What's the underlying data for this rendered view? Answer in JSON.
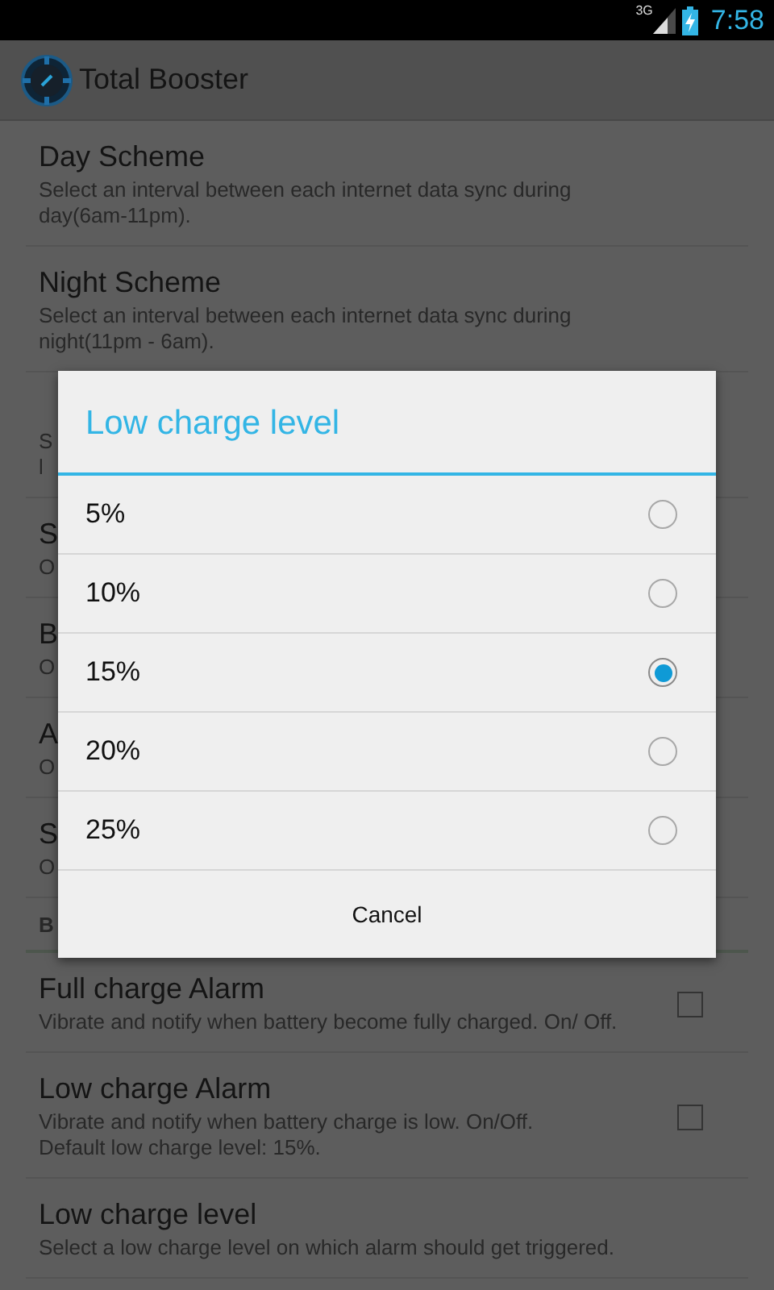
{
  "status_bar": {
    "network": "3G",
    "time": "7:58"
  },
  "app_bar": {
    "title": "Total Booster"
  },
  "settings": [
    {
      "kind": "row",
      "title": "Day Scheme",
      "summary": "Select an interval between each internet data sync during day(6am-11pm)."
    },
    {
      "kind": "row",
      "title": "Night Scheme",
      "summary": "Select an interval between each internet data sync during night(11pm - 6am)."
    },
    {
      "kind": "row",
      "summary": "S\nl"
    },
    {
      "kind": "row",
      "title": "S",
      "summary": "O"
    },
    {
      "kind": "row",
      "title": "B",
      "summary": "O"
    },
    {
      "kind": "row",
      "title": "A",
      "summary": "O"
    },
    {
      "kind": "row",
      "title": "S",
      "summary": "O"
    },
    {
      "kind": "header",
      "title": "B"
    },
    {
      "kind": "check",
      "title": "Full charge Alarm",
      "summary": "Vibrate and notify when battery become fully charged. On/ Off.",
      "checked": false
    },
    {
      "kind": "check",
      "title": "Low charge Alarm",
      "summary": "Vibrate and notify when battery charge is low. On/Off.\nDefault low charge level: 15%.",
      "checked": false
    },
    {
      "kind": "row",
      "title": "Low charge level",
      "summary": "Select a low charge level on which alarm should get triggered."
    }
  ],
  "dialog": {
    "title": "Low charge level",
    "options": [
      {
        "label": "5%",
        "selected": false
      },
      {
        "label": "10%",
        "selected": false
      },
      {
        "label": "15%",
        "selected": true
      },
      {
        "label": "20%",
        "selected": false
      },
      {
        "label": "25%",
        "selected": false
      }
    ],
    "button": "Cancel"
  }
}
